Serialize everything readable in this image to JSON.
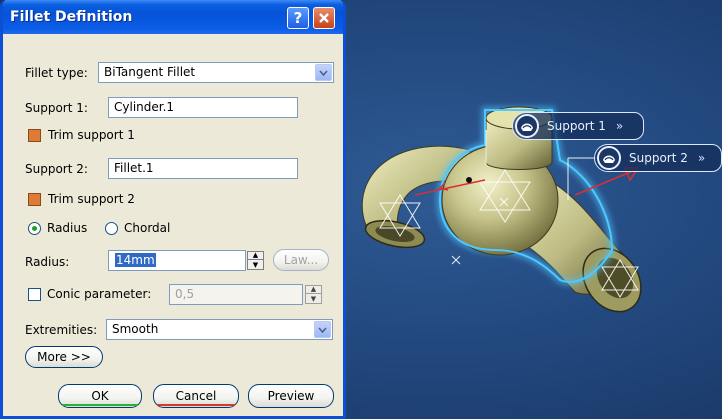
{
  "dialog": {
    "title": "Fillet Definition",
    "help_icon": "help-icon",
    "close_icon": "close-icon",
    "fillet_type_label": "Fillet type:",
    "fillet_type_value": "BiTangent Fillet",
    "support1_label": "Support 1:",
    "support1_value": "Cylinder.1",
    "trim_support1_label": "Trim support 1",
    "trim_support1_checked": true,
    "support2_label": "Support 2:",
    "support2_value": "Fillet.1",
    "trim_support2_label": "Trim support 2",
    "trim_support2_checked": true,
    "radius_option_label": "Radius",
    "chordal_option_label": "Chordal",
    "radius_label": "Radius:",
    "radius_value": "14mm",
    "law_button": "Law...",
    "conic_label": "Conic parameter:",
    "conic_checked": false,
    "conic_value": "0,5",
    "extremities_label": "Extremities:",
    "extremities_value": "Smooth",
    "more_button": "More >>",
    "ok_button": "OK",
    "cancel_button": "Cancel",
    "preview_button": "Preview"
  },
  "viewport": {
    "callouts": [
      {
        "label": "Support 1",
        "chevron": "»",
        "icon": "surface-icon"
      },
      {
        "label": "Support 2",
        "chevron": "»",
        "icon": "surface-icon"
      }
    ],
    "colors": {
      "background": "#234a80",
      "highlight": "#4fc8ff",
      "part": "#c9c98a"
    }
  }
}
